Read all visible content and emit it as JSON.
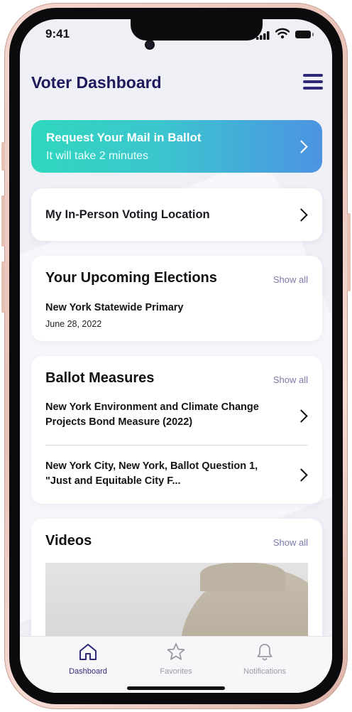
{
  "status_bar": {
    "time": "9:41"
  },
  "header": {
    "title": "Voter Dashboard",
    "menu_icon": "hamburger-menu-icon"
  },
  "ballot_request": {
    "title": "Request Your Mail in Ballot",
    "subtitle": "It will take 2 minutes"
  },
  "voting_location": {
    "label": "My In-Person Voting Location"
  },
  "upcoming_elections": {
    "heading": "Your Upcoming Elections",
    "show_all": "Show all",
    "items": [
      {
        "title": "New York Statewide Primary",
        "date": "June 28, 2022"
      }
    ]
  },
  "ballot_measures": {
    "heading": "Ballot Measures",
    "show_all": "Show all",
    "items": [
      {
        "line1": "New York Environment and Climate Change",
        "line2": "Projects Bond Measure (2022)"
      },
      {
        "line1": "New York City, New York, Ballot Question 1,",
        "line2": "\"Just and Equitable City F..."
      }
    ]
  },
  "videos": {
    "heading": "Videos",
    "show_all": "Show all"
  },
  "tab_bar": {
    "tabs": [
      {
        "label": "Dashboard",
        "icon": "home-icon",
        "active": true
      },
      {
        "label": "Favorites",
        "icon": "star-icon",
        "active": false
      },
      {
        "label": "Notifications",
        "icon": "bell-icon",
        "active": false
      }
    ]
  },
  "colors": {
    "accent": "#2e2a78",
    "gradient_start": "#2fd7bd",
    "gradient_end": "#4c93e2"
  }
}
